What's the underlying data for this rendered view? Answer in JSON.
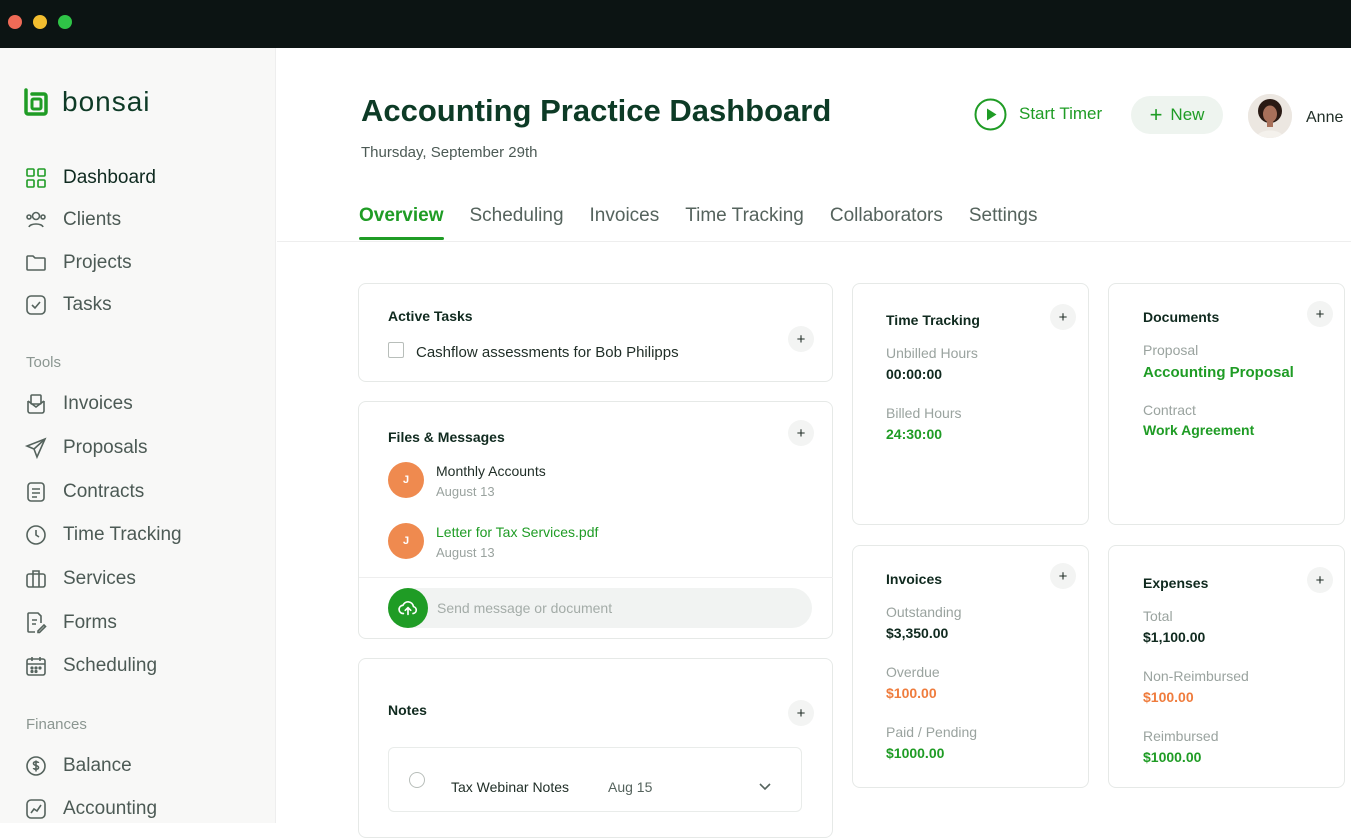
{
  "brand": {
    "name": "bonsai"
  },
  "sidebar": {
    "main_items": [
      {
        "label": "Dashboard",
        "icon": "grid-icon",
        "active": true
      },
      {
        "label": "Clients",
        "icon": "users-icon"
      },
      {
        "label": "Projects",
        "icon": "folder-icon"
      },
      {
        "label": "Tasks",
        "icon": "check-square-icon"
      }
    ],
    "tools_label": "Tools",
    "tools_items": [
      {
        "label": "Invoices",
        "icon": "invoice-icon"
      },
      {
        "label": "Proposals",
        "icon": "send-icon"
      },
      {
        "label": "Contracts",
        "icon": "document-icon"
      },
      {
        "label": "Time Tracking",
        "icon": "clock-icon"
      },
      {
        "label": "Services",
        "icon": "briefcase-icon"
      },
      {
        "label": "Forms",
        "icon": "form-icon"
      },
      {
        "label": "Scheduling",
        "icon": "calendar-icon"
      }
    ],
    "finances_label": "Finances",
    "finances_items": [
      {
        "label": "Balance",
        "icon": "dollar-icon"
      },
      {
        "label": "Accounting",
        "icon": "chart-icon"
      }
    ]
  },
  "header": {
    "title": "Accounting Practice Dashboard",
    "date": "Thursday, September 29th",
    "start_timer_label": "Start Timer",
    "new_label": "New",
    "user_name": "Anne"
  },
  "tabs": [
    {
      "label": "Overview",
      "active": true
    },
    {
      "label": "Scheduling"
    },
    {
      "label": "Invoices"
    },
    {
      "label": "Time Tracking"
    },
    {
      "label": "Collaborators"
    },
    {
      "label": "Settings"
    }
  ],
  "active_tasks": {
    "title": "Active Tasks",
    "items": [
      {
        "text": "Cashflow assessments for Bob Philipps"
      }
    ]
  },
  "files_messages": {
    "title": "Files & Messages",
    "items": [
      {
        "initial": "J",
        "name": "Monthly Accounts",
        "date": "August 13"
      },
      {
        "initial": "J",
        "name": "Letter for Tax Services.pdf",
        "date": "August 13"
      }
    ],
    "input_placeholder": "Send message or document"
  },
  "notes": {
    "title": "Notes",
    "items": [
      {
        "title": "Tax Webinar Notes",
        "date": "Aug 15"
      }
    ]
  },
  "time_tracking": {
    "title": "Time Tracking",
    "unbilled_label": "Unbilled Hours",
    "unbilled_value": "00:00:00",
    "billed_label": "Billed Hours",
    "billed_value": "24:30:00"
  },
  "documents": {
    "title": "Documents",
    "proposal_label": "Proposal",
    "proposal_value": "Accounting Proposal",
    "contract_label": "Contract",
    "contract_value": "Work Agreement"
  },
  "invoices": {
    "title": "Invoices",
    "outstanding_label": "Outstanding",
    "outstanding_value": "$3,350.00",
    "overdue_label": "Overdue",
    "overdue_value": "$100.00",
    "paid_label": "Paid / Pending",
    "paid_value": "$1000.00"
  },
  "expenses": {
    "title": "Expenses",
    "total_label": "Total",
    "total_value": "$1,100.00",
    "nonreimbursed_label": "Non-Reimbursed",
    "nonreimbursed_value": "$100.00",
    "reimbursed_label": "Reimbursed",
    "reimbursed_value": "$1000.00"
  },
  "colors": {
    "brand_green": "#1f9c25",
    "dark_green": "#0d3b26",
    "warning_orange": "#ef7c3d",
    "titlebar": "#0c1413"
  }
}
